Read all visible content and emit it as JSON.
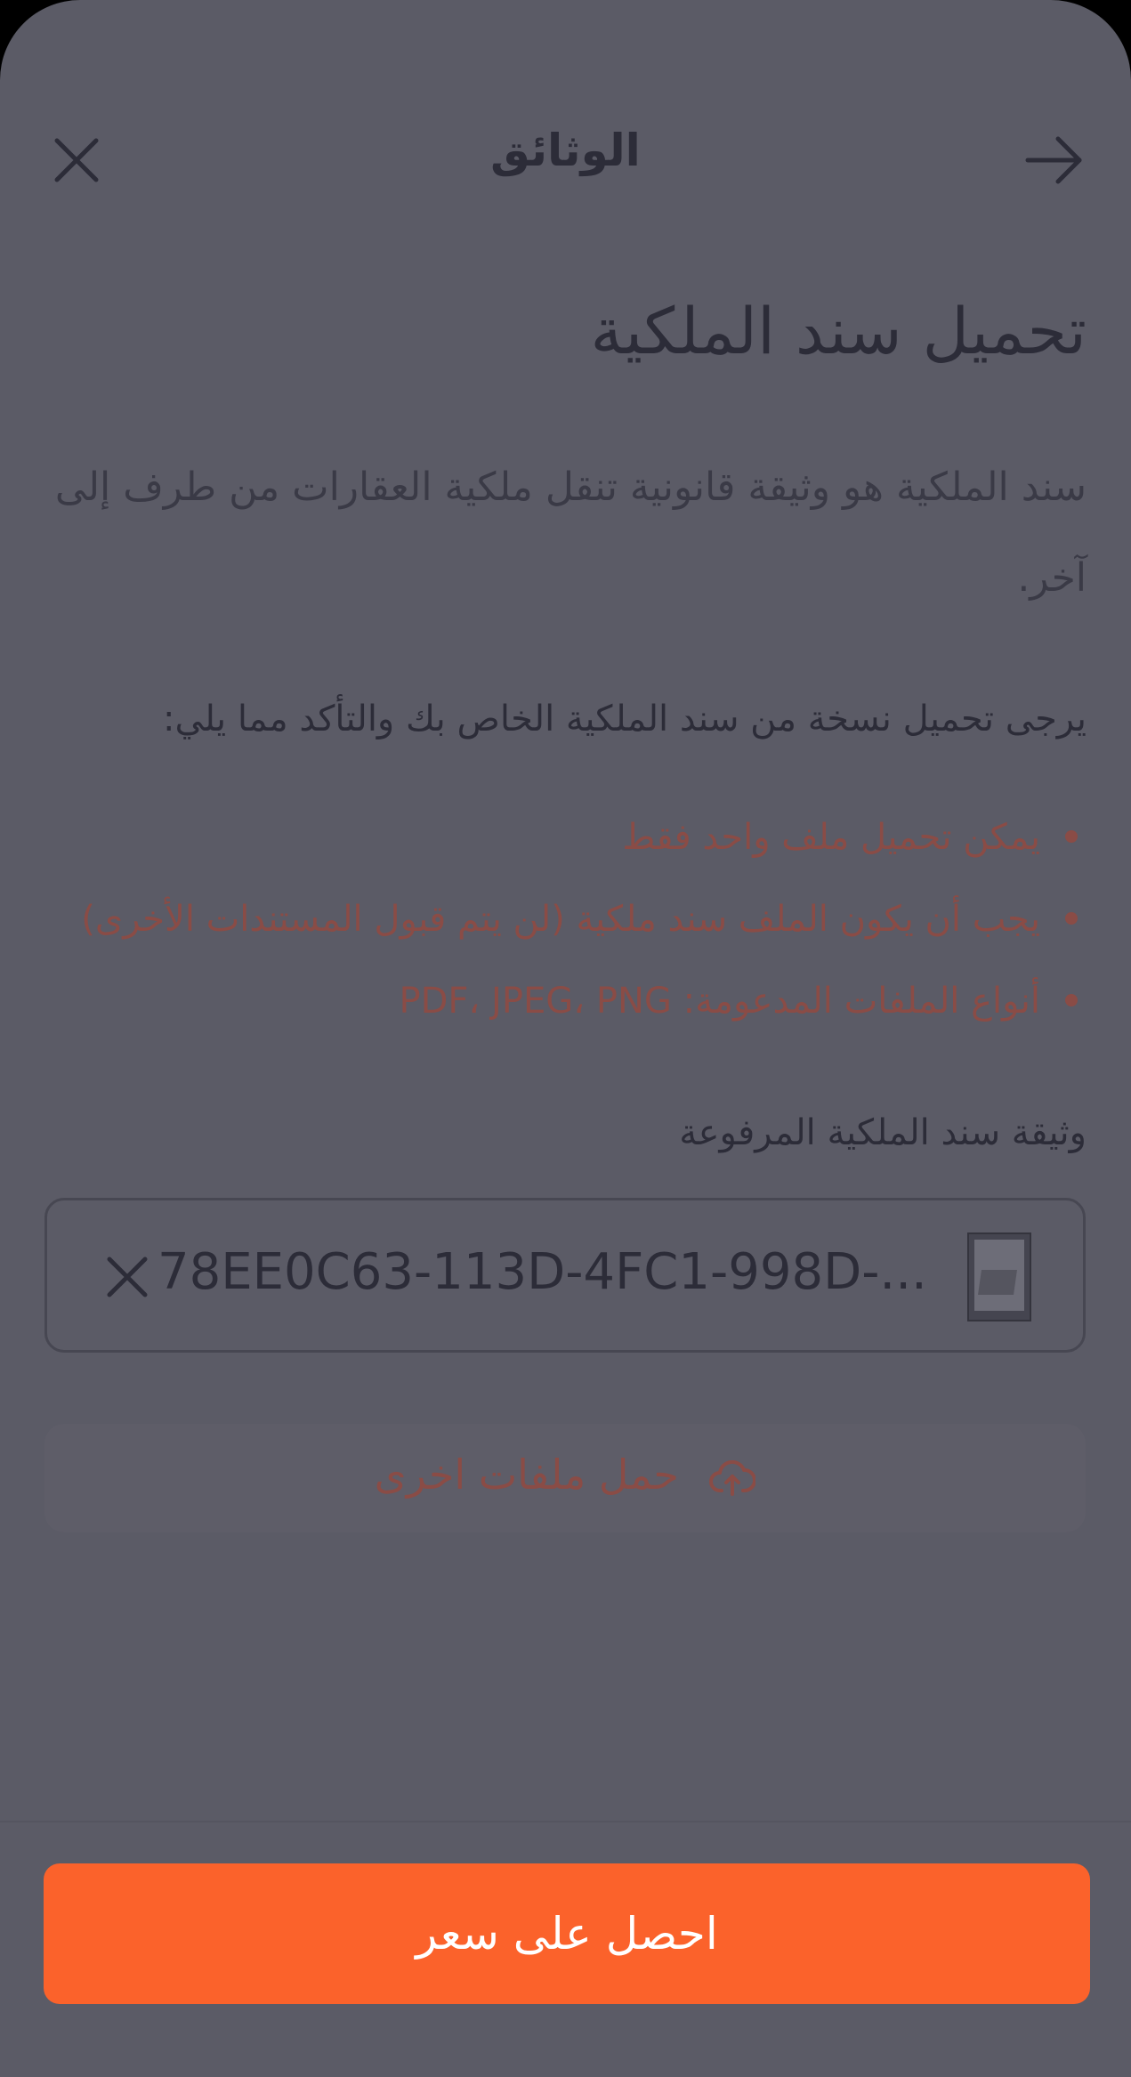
{
  "header": {
    "title": "الوثائق"
  },
  "page": {
    "title": "تحميل سند الملكية",
    "description": "سند الملكية هو وثيقة قانونية تنقل ملكية العقارات من طرف إلى آخر.",
    "instruction": "يرجى تحميل نسخة من سند الملكية الخاص بك والتأكد مما يلي:",
    "requirements": [
      "يمكن تحميل ملف واحد فقط",
      "يجب أن يكون الملف سند ملكية (لن يتم قبول المستندات الأخرى)",
      "أنواع الملفات المدعومة: PDF، JPEG، PNG"
    ]
  },
  "uploaded": {
    "label": "وثيقة سند الملكية المرفوعة",
    "file_name": "78EE0C63-113D-4FC1-998D-..."
  },
  "upload_more": {
    "label": "حمل ملفات اخرى"
  },
  "cta": {
    "label": "احصل على سعر"
  },
  "colors": {
    "overlay_bg": "#5b5b66",
    "accent": "#fb622b",
    "text_dark": "#2c2c38",
    "muted_accent": "#8a4c46"
  }
}
